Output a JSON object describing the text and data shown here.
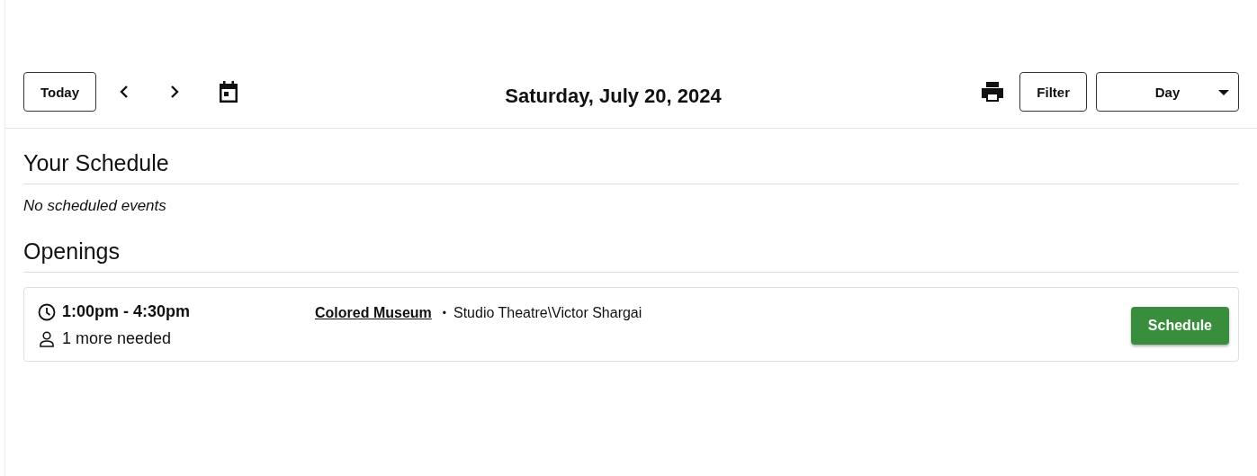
{
  "toolbar": {
    "today_button": "Today",
    "date_title": "Saturday, July 20, 2024",
    "filter_button": "Filter",
    "view_select": {
      "value": "Day"
    }
  },
  "your_schedule": {
    "heading": "Your Schedule",
    "empty_message": "No scheduled events"
  },
  "openings": {
    "heading": "Openings",
    "items": [
      {
        "time": "1:00pm - 4:30pm",
        "needed": "1 more needed",
        "event": "Colored Museum",
        "separator": "•",
        "location": "Studio Theatre\\Victor Shargai",
        "action": "Schedule"
      }
    ]
  }
}
